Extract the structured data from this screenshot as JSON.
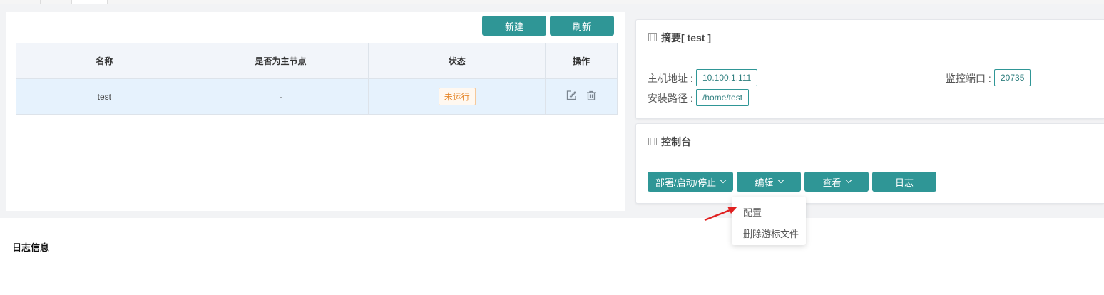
{
  "toolbar": {
    "new_label": "新建",
    "refresh_label": "刷新"
  },
  "table": {
    "headers": [
      "名称",
      "是否为主节点",
      "状态",
      "操作"
    ],
    "rows": [
      {
        "name": "test",
        "is_master": "-",
        "status": "未运行"
      }
    ]
  },
  "summary": {
    "title": "摘要[ test ]",
    "host_label": "主机地址 :",
    "host_value": "10.100.1.111",
    "port_label": "监控端口 :",
    "port_value": "20735",
    "path_label": "安装路径 :",
    "path_value": "/home/test"
  },
  "console": {
    "title": "控制台",
    "buttons": {
      "deploy": "部署/启动/停止",
      "edit": "编辑",
      "view": "查看",
      "log": "日志"
    }
  },
  "dropdown": {
    "items": [
      "配置",
      "删除游标文件"
    ]
  },
  "log": {
    "title": "日志信息"
  },
  "colors": {
    "accent": "#2f9696",
    "warning": "#e6882c",
    "arrow": "#e02020"
  }
}
